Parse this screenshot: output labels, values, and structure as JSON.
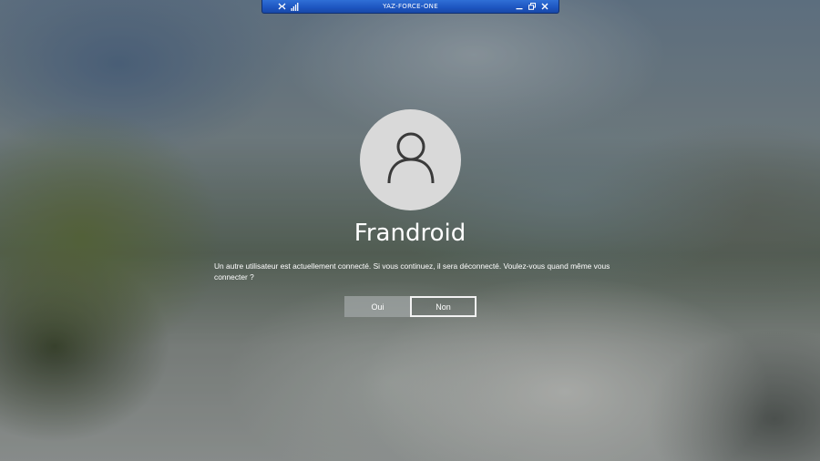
{
  "rdp_bar": {
    "title": "YAZ-FORCE-ONE",
    "icons": [
      "pin-icon",
      "signal-icon",
      "minimize-icon",
      "restore-icon",
      "close-icon"
    ],
    "color": "#1d55c0"
  },
  "login": {
    "avatar_icon": "user-icon",
    "user_name": "Frandroid",
    "message": "Un autre utilisateur est actuellement connecté. Si vous continuez, il sera déconnecté. Voulez-vous quand même vous connecter ?",
    "buttons": {
      "yes_label": "Oui",
      "no_label": "Non"
    }
  }
}
